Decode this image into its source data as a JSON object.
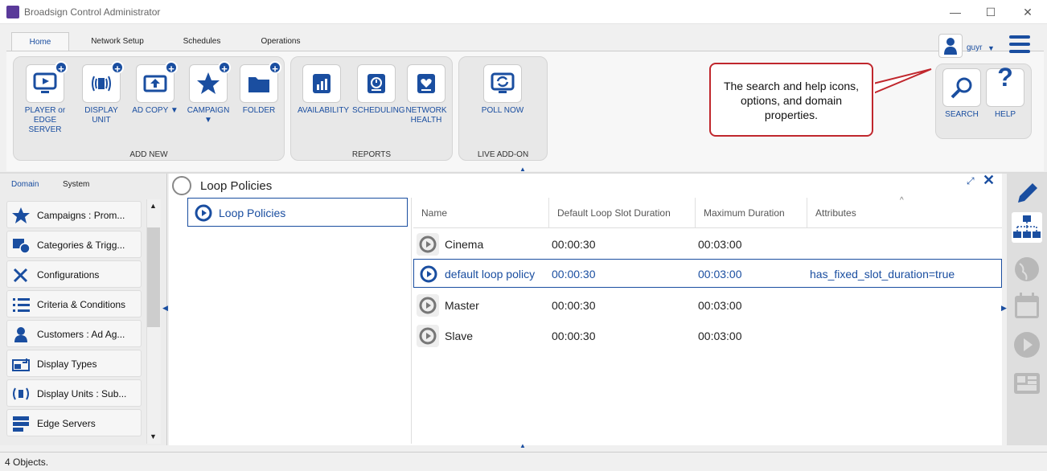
{
  "window": {
    "title": "Broadsign Control Administrator",
    "minimize": "—",
    "maximize": "☐",
    "close": "✕"
  },
  "ribbon": {
    "tabs": [
      "Home",
      "Network Setup",
      "Schedules",
      "Operations"
    ],
    "groups": {
      "add_new": {
        "label": "ADD NEW",
        "buttons": [
          {
            "label1": "PLAYER or",
            "label2": "EDGE SERVER",
            "icon": "player-icon"
          },
          {
            "label1": "DISPLAY UNIT",
            "label2": "",
            "icon": "display-unit-icon"
          },
          {
            "label1": "AD COPY ▼",
            "label2": "",
            "icon": "ad-copy-icon"
          },
          {
            "label1": "CAMPAIGN ▼",
            "label2": "",
            "icon": "campaign-star-icon"
          },
          {
            "label1": "FOLDER",
            "label2": "",
            "icon": "folder-icon"
          }
        ]
      },
      "reports": {
        "label": "REPORTS",
        "buttons": [
          {
            "label1": "AVAILABILITY",
            "label2": "",
            "icon": "availability-icon"
          },
          {
            "label1": "SCHEDULING",
            "label2": "",
            "icon": "scheduling-icon"
          },
          {
            "label1": "NETWORK",
            "label2": "HEALTH",
            "icon": "network-health-icon"
          }
        ]
      },
      "live": {
        "label": "LIVE ADD-ON",
        "buttons": [
          {
            "label1": "POLL NOW",
            "label2": "",
            "icon": "poll-now-icon"
          }
        ]
      }
    },
    "search_label": "SEARCH",
    "help_label": "HELP"
  },
  "user": {
    "name": "guyr"
  },
  "callout": {
    "text": "The search and help icons, options, and domain properties."
  },
  "left_panel": {
    "tabs": [
      "Domain",
      "System"
    ],
    "items": [
      {
        "label": "Campaigns : Prom...",
        "icon": "star-icon"
      },
      {
        "label": "Categories & Trigg...",
        "icon": "categories-icon"
      },
      {
        "label": "Configurations",
        "icon": "tools-icon"
      },
      {
        "label": "Criteria & Conditions",
        "icon": "checklist-icon"
      },
      {
        "label": "Customers : Ad Ag...",
        "icon": "customer-icon"
      },
      {
        "label": "Display Types",
        "icon": "display-types-icon"
      },
      {
        "label": "Display Units : Sub...",
        "icon": "display-unit-icon"
      },
      {
        "label": "Edge Servers",
        "icon": "server-icon"
      }
    ]
  },
  "content": {
    "title": "Loop Policies",
    "tree_item": "Loop Policies",
    "columns": [
      "Name",
      "Default Loop Slot Duration",
      "Maximum Duration",
      "Attributes"
    ],
    "rows": [
      {
        "name": "Cinema",
        "default": "00:00:30",
        "max": "00:03:00",
        "attributes": ""
      },
      {
        "name": "default loop policy",
        "default": "00:00:30",
        "max": "00:03:00",
        "attributes": "has_fixed_slot_duration=true"
      },
      {
        "name": "Master",
        "default": "00:00:30",
        "max": "00:03:00",
        "attributes": ""
      },
      {
        "name": "Slave",
        "default": "00:00:30",
        "max": "00:03:00",
        "attributes": ""
      }
    ]
  },
  "status": {
    "text": "4 Objects."
  },
  "colors": {
    "accent": "#1a4ea0",
    "callout_border": "#c0272d"
  }
}
